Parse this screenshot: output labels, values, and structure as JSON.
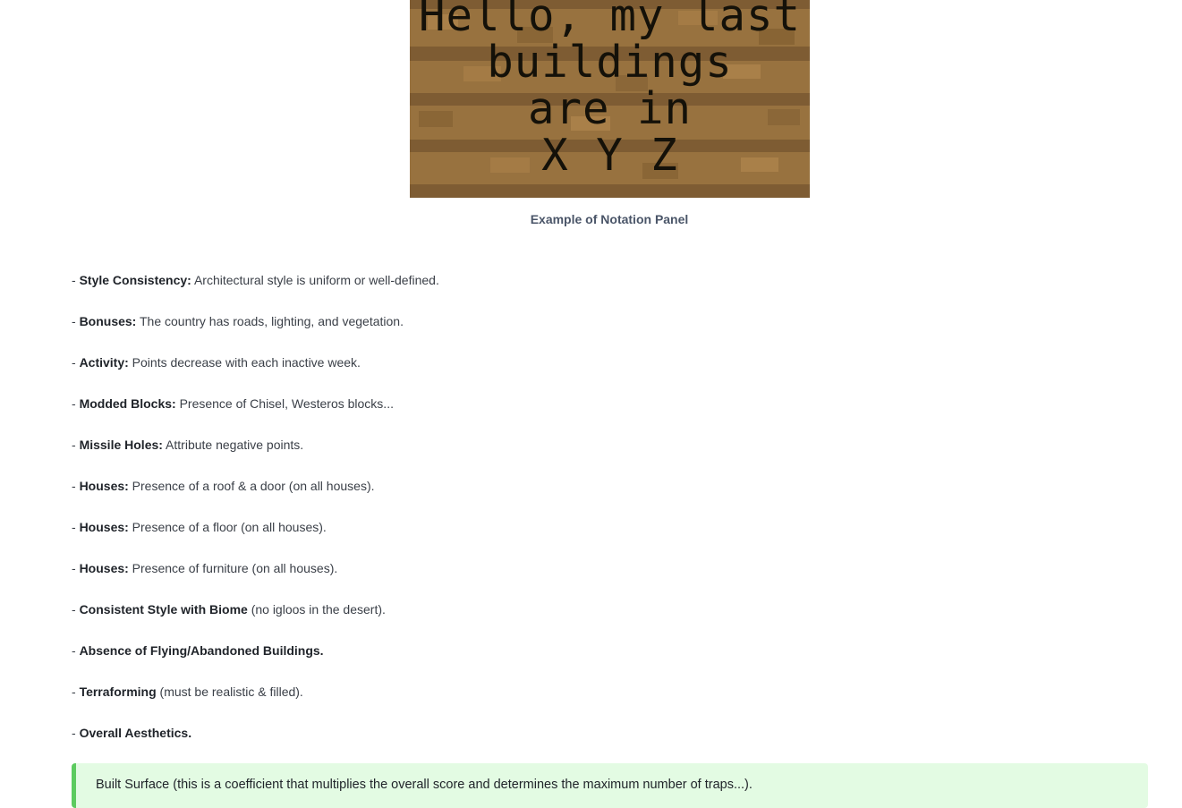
{
  "sign_image": {
    "lines": [
      "Hello, my last",
      "buildings",
      "are in",
      "X Y Z"
    ]
  },
  "caption": "Example of Notation Panel",
  "criteria": [
    {
      "prefix": "- ",
      "bold": "Style Consistency:",
      "text": " Architectural style is uniform or well-defined."
    },
    {
      "prefix": "- ",
      "bold": "Bonuses:",
      "text": " The country has roads, lighting, and vegetation."
    },
    {
      "prefix": "- ",
      "bold": "Activity:",
      "text": " Points decrease with each inactive week."
    },
    {
      "prefix": "- ",
      "bold": "Modded Blocks:",
      "text": " Presence of Chisel, Westeros blocks..."
    },
    {
      "prefix": "- ",
      "bold": "Missile Holes:",
      "text": " Attribute negative points."
    },
    {
      "prefix": "- ",
      "bold": "Houses:",
      "text": " Presence of a roof & a door (on all houses)."
    },
    {
      "prefix": "- ",
      "bold": "Houses:",
      "text": " Presence of a floor (on all houses)."
    },
    {
      "prefix": "- ",
      "bold": "Houses:",
      "text": " Presence of furniture (on all houses)."
    },
    {
      "prefix": "- ",
      "bold": "Consistent Style with Biome",
      "text": " (no igloos in the desert)."
    },
    {
      "prefix": "- ",
      "bold": "Absence of Flying/Abandoned Buildings.",
      "text": ""
    },
    {
      "prefix": "- ",
      "bold": "Terraforming",
      "text": " (must be realistic & filled)."
    },
    {
      "prefix": "- ",
      "bold": "Overall Aesthetics.",
      "text": ""
    }
  ],
  "callout": {
    "text": "Built Surface (this is a coefficient that multiplies the overall score and determines the maximum number of traps...)."
  },
  "colors": {
    "callout_bg": "#e3fbe3",
    "callout_border": "#5ccb5f",
    "sign_wood": "#96703f"
  }
}
